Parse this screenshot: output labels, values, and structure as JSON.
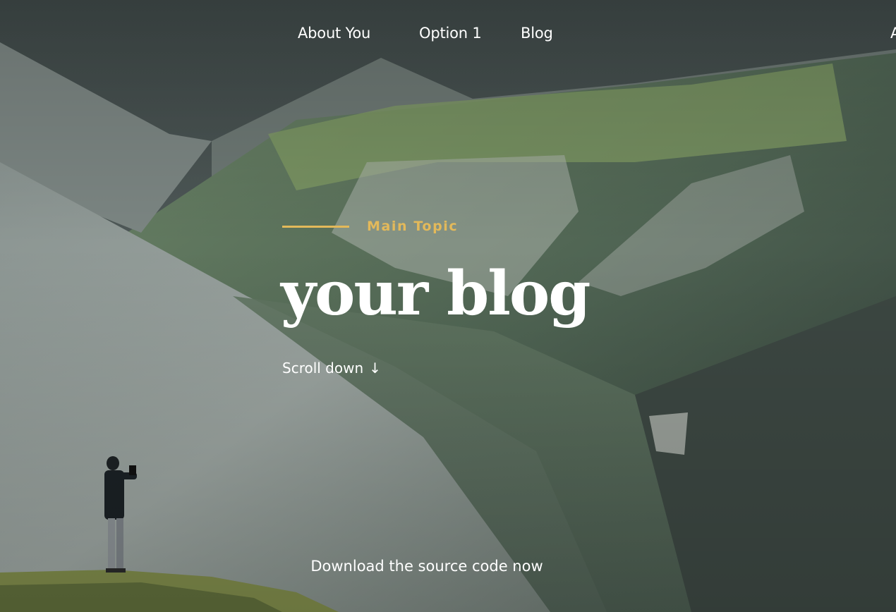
{
  "nav": {
    "items": [
      {
        "label": "About You"
      },
      {
        "label": "Option 1"
      },
      {
        "label": "Blog"
      }
    ],
    "overflow_glyph": "A"
  },
  "hero": {
    "topic": "Main Topic",
    "title": "your blog",
    "scroll_label": "Scroll down",
    "scroll_arrow": "↓",
    "download_label": "Download the source code now"
  },
  "colors": {
    "accent": "#e3b95a",
    "text": "#ffffff"
  }
}
